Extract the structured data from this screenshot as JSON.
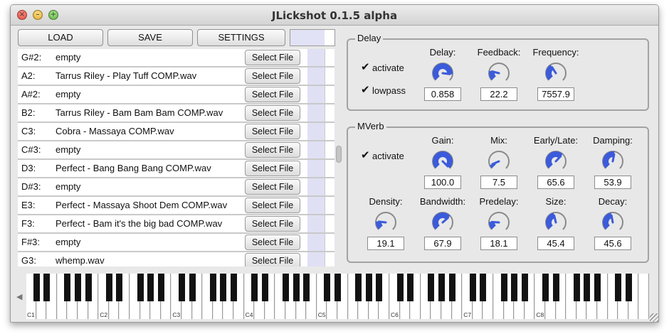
{
  "window": {
    "title": "JLickshot 0.1.5 alpha"
  },
  "toolbar": {
    "load_label": "LOAD",
    "save_label": "SAVE",
    "settings_label": "SETTINGS"
  },
  "samples": [
    {
      "note": "G#2:",
      "file": "empty"
    },
    {
      "note": "A2:",
      "file": "Tarrus Riley - Play Tuff COMP.wav"
    },
    {
      "note": "A#2:",
      "file": "empty"
    },
    {
      "note": "B2:",
      "file": "Tarrus Riley - Bam Bam Bam COMP.wav"
    },
    {
      "note": "C3:",
      "file": "Cobra - Massaya COMP.wav"
    },
    {
      "note": "C#3:",
      "file": "empty"
    },
    {
      "note": "D3:",
      "file": "Perfect - Bang Bang Bang COMP.wav"
    },
    {
      "note": "D#3:",
      "file": "empty"
    },
    {
      "note": "E3:",
      "file": "Perfect - Massaya Shoot Dem COMP.wav"
    },
    {
      "note": "F3:",
      "file": "Perfect - Bam it's the big bad COMP.wav"
    },
    {
      "note": "F#3:",
      "file": "empty"
    },
    {
      "note": "G3:",
      "file": "whemp.wav"
    }
  ],
  "select_file_label": "Select File",
  "delay": {
    "legend": "Delay",
    "activate_label": "activate",
    "lowpass_label": "lowpass",
    "knobs": [
      {
        "label": "Delay:",
        "value": "0.858",
        "level": 0.86
      },
      {
        "label": "Feedback:",
        "value": "22.2",
        "level": 0.22
      },
      {
        "label": "Frequency:",
        "value": "7557.9",
        "level": 0.38
      }
    ]
  },
  "mverb": {
    "legend": "MVerb",
    "activate_label": "activate",
    "knobs": [
      {
        "label": "Gain:",
        "value": "100.0",
        "level": 1.0
      },
      {
        "label": "Mix:",
        "value": "7.5",
        "level": 0.08
      },
      {
        "label": "Early/Late:",
        "value": "65.6",
        "level": 0.66
      },
      {
        "label": "Damping:",
        "value": "53.9",
        "level": 0.54
      },
      {
        "label": "Density:",
        "value": "19.1",
        "level": 0.19
      },
      {
        "label": "Bandwidth:",
        "value": "67.9",
        "level": 0.68
      },
      {
        "label": "Predelay:",
        "value": "18.1",
        "level": 0.18
      },
      {
        "label": "Size:",
        "value": "45.4",
        "level": 0.45
      },
      {
        "label": "Decay:",
        "value": "45.6",
        "level": 0.46
      }
    ]
  },
  "keyboard": {
    "octave_labels": [
      "C1",
      "C2",
      "C3",
      "C4",
      "C5",
      "C6",
      "C7",
      "C8"
    ]
  },
  "colors": {
    "knob_fill": "#3b5bdb",
    "knob_track": "#8a8a8a",
    "meter": "#e0e0f4"
  }
}
